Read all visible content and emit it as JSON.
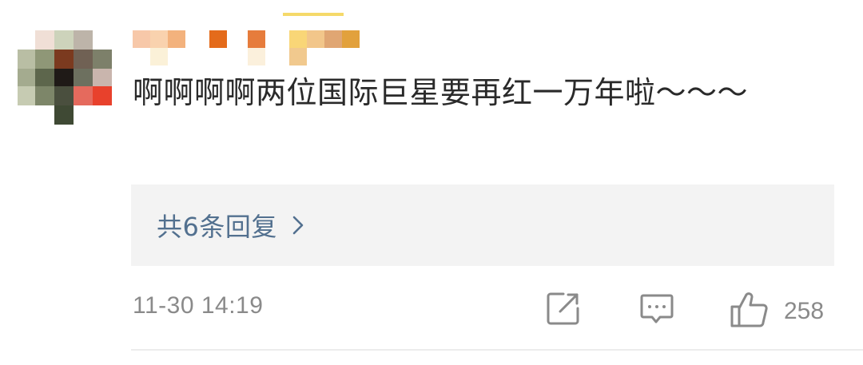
{
  "comment": {
    "text": "啊啊啊啊两位国际巨星要再红一万年啦～～～",
    "replies_label": "共6条回复",
    "timestamp": "11-30 14:19",
    "like_count": "258"
  },
  "icons": {
    "replies_chevron": "chevron-right-icon",
    "share": "share-icon",
    "comment": "comment-icon",
    "like": "thumbs-up-icon"
  },
  "colors": {
    "text": "#2a2a2a",
    "link": "#52708f",
    "meta": "#8a8a8a",
    "reply_bg": "#f3f3f3"
  }
}
